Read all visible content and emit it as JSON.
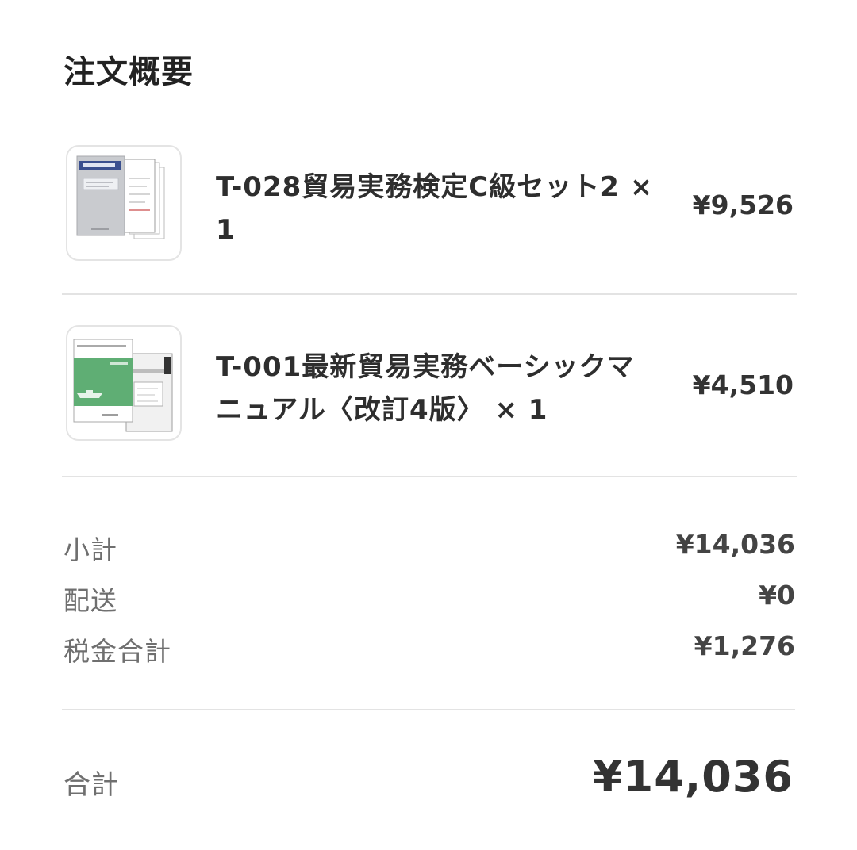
{
  "page": {
    "title": "注文概要"
  },
  "items": [
    {
      "name": "T-028貿易実務検定C級セット2 × 1",
      "price": "¥9,526",
      "thumbnail_icon": "book-set-thumbnail-icon",
      "thumbnail_accent": "#3a4f8f"
    },
    {
      "name": "T-001最新貿易実務ベーシックマニュアル〈改訂4版〉 × 1",
      "price": "¥4,510",
      "thumbnail_icon": "book-manual-thumbnail-icon",
      "thumbnail_accent": "#5fae74"
    }
  ],
  "summary": {
    "subtotal_label": "小計",
    "subtotal_value": "¥14,036",
    "shipping_label": "配送",
    "shipping_value": "¥0",
    "tax_label": "税金合計",
    "tax_value": "¥1,276"
  },
  "total": {
    "label": "合計",
    "value": "¥14,036"
  }
}
